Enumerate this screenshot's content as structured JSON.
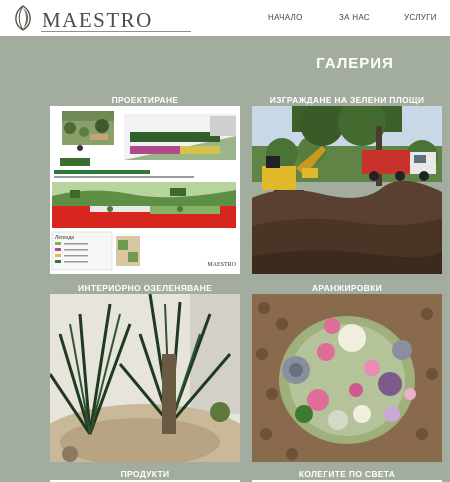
{
  "header": {
    "brand": "MAESTRO",
    "nav": {
      "home": "НАЧАЛО",
      "about": "ЗА НАС",
      "services": "УСЛУГИ"
    }
  },
  "gallery": {
    "title": "ГАЛЕРИЯ",
    "items": [
      {
        "label": "ПРОЕКТИРАНЕ",
        "image_icon": "landscape-design-plan"
      },
      {
        "label": "ИЗГРАЖДАНЕ НА ЗЕЛЕНИ ПЛОЩИ",
        "image_icon": "excavator-construction-site"
      },
      {
        "label": "ИНТЕРИОРНО ОЗЕЛЕНЯВАНЕ",
        "image_icon": "indoor-palm-planter"
      },
      {
        "label": "АРАНЖИРОВКИ",
        "image_icon": "flower-arrangement"
      },
      {
        "label": "ПРОДУКТИ"
      },
      {
        "label": "КОЛЕГИТЕ ПО СВЕТА"
      }
    ],
    "plan": {
      "legend_title": "Легенда",
      "stamp": "MAESTRO"
    }
  },
  "colors": {
    "page_background": "#a3ad9f",
    "header_background": "#ffffff",
    "heading_text": "#ffffff"
  }
}
